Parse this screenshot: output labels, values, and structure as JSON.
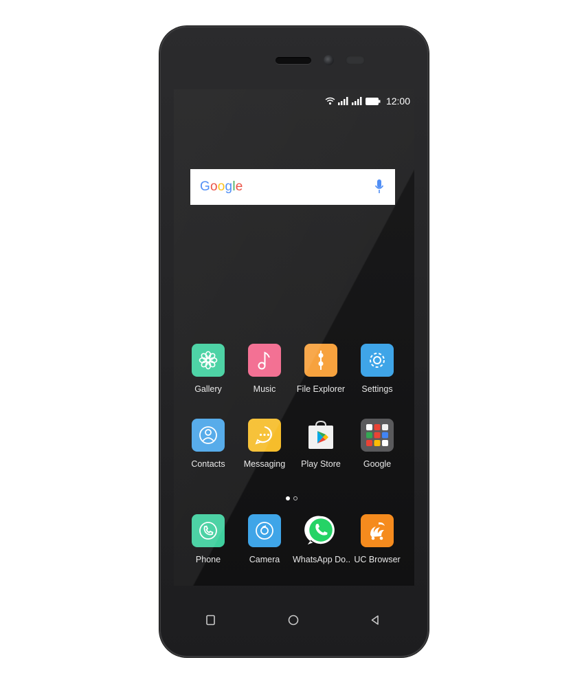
{
  "status_bar": {
    "time": "12:00"
  },
  "search": {
    "logo_letters": [
      {
        "ch": "G",
        "color": "#4285F4"
      },
      {
        "ch": "o",
        "color": "#EA4335"
      },
      {
        "ch": "o",
        "color": "#FBBC05"
      },
      {
        "ch": "g",
        "color": "#4285F4"
      },
      {
        "ch": "l",
        "color": "#34A853"
      },
      {
        "ch": "e",
        "color": "#EA4335"
      }
    ],
    "mic_color": "#4285F4"
  },
  "apps": {
    "gallery": {
      "label": "Gallery",
      "icon": "gallery-icon",
      "color": "#3fcf9e"
    },
    "music": {
      "label": "Music",
      "icon": "music-icon",
      "color": "#f2668b"
    },
    "file_explorer": {
      "label": "File Explorer",
      "icon": "file-explorer-icon",
      "color": "#f7a23e"
    },
    "settings": {
      "label": "Settings",
      "icon": "settings-icon",
      "color": "#3fa5e8"
    },
    "contacts": {
      "label": "Contacts",
      "icon": "contacts-icon",
      "color": "#4aa5e8"
    },
    "messaging": {
      "label": "Messaging",
      "icon": "messaging-icon",
      "color": "#f6bd2b"
    },
    "play_store": {
      "label": "Play Store",
      "icon": "play-store-icon",
      "color": "#f1f1f1"
    },
    "google": {
      "label": "Google",
      "icon": "google-folder-icon",
      "color": "#5a5a5c"
    },
    "phone": {
      "label": "Phone",
      "icon": "phone-icon",
      "color": "#3fcf9e"
    },
    "camera": {
      "label": "Camera",
      "icon": "camera-icon",
      "color": "#3fa5e8"
    },
    "whatsapp": {
      "label": "WhatsApp Do..",
      "icon": "whatsapp-icon",
      "color": "#25d366"
    },
    "uc_browser": {
      "label": "UC Browser",
      "icon": "uc-browser-icon",
      "color": "#f58b1e"
    }
  },
  "page_indicator": {
    "pages": 2,
    "active": 1
  }
}
